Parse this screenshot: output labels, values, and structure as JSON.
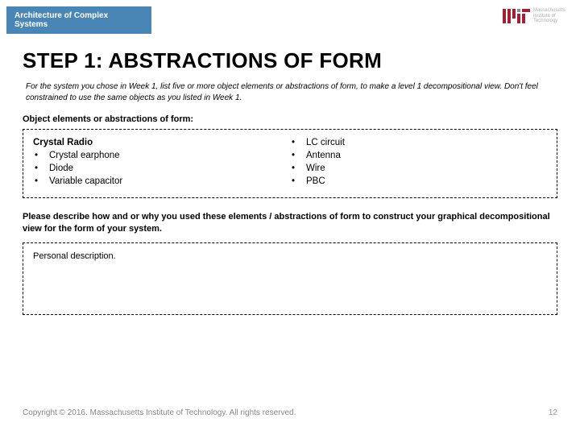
{
  "header": {
    "course_title": "Architecture of Complex Systems"
  },
  "logo": {
    "line1": "Massachusetts",
    "line2": "Institute of",
    "line3": "Technology"
  },
  "main": {
    "step_title": "STEP 1: ABSTRACTIONS OF FORM",
    "instruction": "For the system you chose in Week 1, list five or more object elements or abstractions of form, to make a level 1 decompositional view.  Don't feel constrained to use the same objects as you listed  in Week 1.",
    "elements_label": "Object elements or abstractions of form:",
    "system_name": "Crystal Radio",
    "left_items": [
      "Crystal earphone",
      "Diode",
      "Variable capacitor"
    ],
    "right_items": [
      "LC circuit",
      "Antenna",
      "Wire",
      "PBC"
    ],
    "describe_prompt": "Please describe how and or why you used these elements / abstractions of form to construct your graphical decompositional view for the form of your system.",
    "description_placeholder": "Personal description."
  },
  "footer": {
    "copyright": "Copyright © 2016. Massachusetts Institute of Technology. All rights reserved.",
    "page_number": "12"
  }
}
